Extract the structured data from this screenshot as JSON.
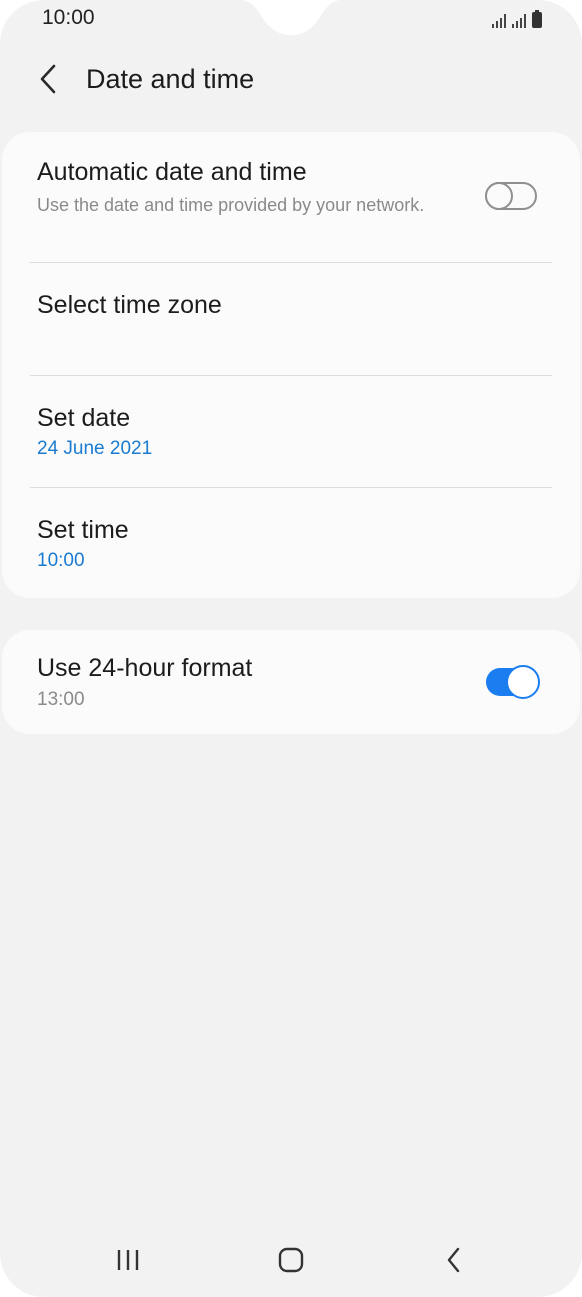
{
  "status_bar": {
    "time": "10:00",
    "icons": [
      "signal-icon",
      "signal-icon",
      "battery-icon"
    ]
  },
  "header": {
    "back_icon": "chevron-left-icon",
    "title": "Date and time"
  },
  "settings": {
    "automatic": {
      "title": "Automatic date and time",
      "subtitle": "Use the date and time provided by your network.",
      "enabled": false
    },
    "time_zone": {
      "title": "Select time zone"
    },
    "set_date": {
      "title": "Set date",
      "value": "24 June 2021"
    },
    "set_time": {
      "title": "Set time",
      "value": "10:00"
    },
    "hour_format": {
      "title": "Use 24-hour format",
      "value": "13:00",
      "enabled": true
    }
  },
  "colors": {
    "accent": "#1a7ef0",
    "value_blue": "#1a7bd0",
    "background": "#f2f2f2",
    "card": "#fbfbfb"
  },
  "nav_bar": {
    "icons": [
      "recent-apps-icon",
      "home-icon",
      "back-icon"
    ]
  }
}
